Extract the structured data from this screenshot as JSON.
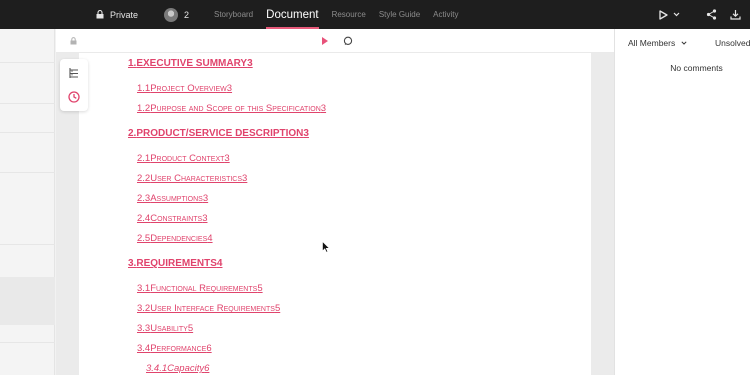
{
  "topbar": {
    "privacy_label": "Private",
    "collaborator_count": "2",
    "tabs": [
      {
        "label": "Storyboard",
        "active": false
      },
      {
        "label": "Document",
        "active": true
      },
      {
        "label": "Resource",
        "active": false
      },
      {
        "label": "Style Guide",
        "active": false
      },
      {
        "label": "Activity",
        "active": false
      }
    ],
    "icons": [
      "lock-icon",
      "avatar",
      "play-icon",
      "chevron-down-icon",
      "share-icon",
      "download-icon"
    ]
  },
  "document_toolbar": {
    "icons": [
      "lock-icon",
      "play-icon",
      "comment-icon"
    ]
  },
  "side_tools": {
    "icons": [
      "outline-icon",
      "history-icon"
    ]
  },
  "toc": [
    {
      "level": 1,
      "number": "1.",
      "title": "EXECUTIVE SUMMARY",
      "page": "3"
    },
    {
      "level": 2,
      "number": "1.1",
      "title": "Project Overview",
      "page": "3"
    },
    {
      "level": 2,
      "number": "1.2",
      "title": "Purpose and Scope of this Specification",
      "page": "3"
    },
    {
      "level": 1,
      "number": "2.",
      "title": "PRODUCT/SERVICE DESCRIPTION",
      "page": "3"
    },
    {
      "level": 2,
      "number": "2.1",
      "title": "Product Context",
      "page": "3"
    },
    {
      "level": 2,
      "number": "2.2",
      "title": "User Characteristics",
      "page": "3"
    },
    {
      "level": 2,
      "number": "2.3",
      "title": "Assumptions",
      "page": "3"
    },
    {
      "level": 2,
      "number": "2.4",
      "title": "Constraints",
      "page": "3"
    },
    {
      "level": 2,
      "number": "2.5",
      "title": "Dependencies",
      "page": "4"
    },
    {
      "level": 1,
      "number": "3.",
      "title": "REQUIREMENTS",
      "page": "4"
    },
    {
      "level": 2,
      "number": "3.1",
      "title": "Functional Requirements",
      "page": "5"
    },
    {
      "level": 2,
      "number": "3.2",
      "title": "User Interface Requirements",
      "page": "5"
    },
    {
      "level": 2,
      "number": "3.3",
      "title": "Usability",
      "page": "5"
    },
    {
      "level": 2,
      "number": "3.4",
      "title": "Performance",
      "page": "6"
    },
    {
      "level": 3,
      "number": "3.4.1",
      "title": "Capacity",
      "page": "6"
    }
  ],
  "comments_panel": {
    "filter_label": "All Members",
    "status_label": "Unsolved",
    "empty_text": "No comments"
  },
  "colors": {
    "accent": "#e0436c",
    "topbar_bg": "#1e1e1e"
  }
}
